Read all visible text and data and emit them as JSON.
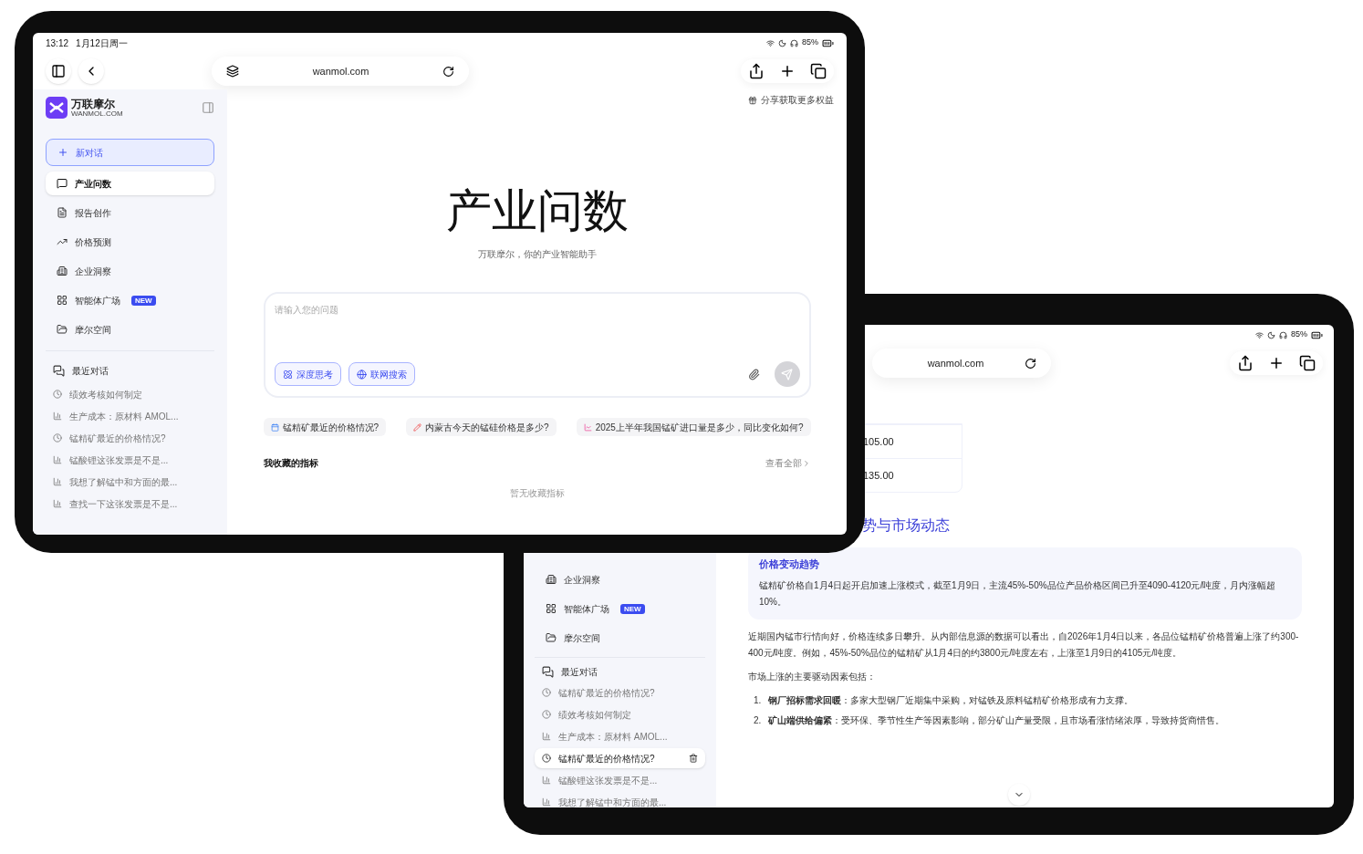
{
  "front": {
    "status": {
      "time": "13:12",
      "date": "1月12日周一",
      "battery": "85%"
    },
    "url": "wanmol.com",
    "brand": {
      "name": "万联摩尔",
      "domain": "WANMOL.COM"
    },
    "new_chat": "新对话",
    "nav": [
      {
        "label": "产业问数",
        "selected": true
      },
      {
        "label": "报告创作",
        "selected": false
      },
      {
        "label": "价格预测",
        "selected": false
      },
      {
        "label": "企业洞察",
        "selected": false
      },
      {
        "label": "智能体广场",
        "selected": false,
        "badge": "NEW"
      },
      {
        "label": "摩尔空间",
        "selected": false
      }
    ],
    "recent_title": "最近对话",
    "history": [
      {
        "label": "绩效考核如何制定",
        "kind": "chat"
      },
      {
        "label": "生产成本：原材料 AMOL...",
        "kind": "report"
      },
      {
        "label": "锰精矿最近的价格情况?",
        "kind": "chat"
      },
      {
        "label": "锰酸锂这张发票是不是...",
        "kind": "report"
      },
      {
        "label": "我想了解锰中和方面的最...",
        "kind": "report"
      },
      {
        "label": "查找一下这张发票是不是...",
        "kind": "report"
      }
    ],
    "share": "分享获取更多权益",
    "hero": {
      "title": "产业问数",
      "subtitle": "万联摩尔，你的产业智能助手"
    },
    "input": {
      "placeholder": "请输入您的问题"
    },
    "modes": [
      {
        "label": "深度思考",
        "kind": "think"
      },
      {
        "label": "联网搜索",
        "kind": "web"
      }
    ],
    "suggestions": [
      {
        "label": "锰精矿最近的价格情况?",
        "kind": "calendar"
      },
      {
        "label": "内蒙古今天的锰硅价格是多少?",
        "kind": "pen"
      },
      {
        "label": "2025上半年我国锰矿进口量是多少，同比变化如何?",
        "kind": "trend"
      }
    ],
    "favorites": {
      "title": "我收藏的指标",
      "link": "查看全部",
      "empty": "暂无收藏指标"
    }
  },
  "back": {
    "status": {
      "battery": "85%"
    },
    "url": "wanmol.com",
    "nav": [
      {
        "label": "企业洞察"
      },
      {
        "label": "智能体广场",
        "badge": "NEW"
      },
      {
        "label": "摩尔空间"
      }
    ],
    "recent_title": "最近对话",
    "history": [
      {
        "label": "锰精矿最近的价格情况?",
        "kind": "chat",
        "selected": false
      },
      {
        "label": "绩效考核如何制定",
        "kind": "chat",
        "selected": false
      },
      {
        "label": "生产成本：原材料 AMOL...",
        "kind": "report",
        "selected": false
      },
      {
        "label": "锰精矿最近的价格情况?",
        "kind": "chat",
        "selected": true
      },
      {
        "label": "锰酸锂这张发票是不是...",
        "kind": "report",
        "selected": false
      },
      {
        "label": "我想了解锰中和方面的最...",
        "kind": "report",
        "selected": false
      }
    ],
    "table_cells": [
      "105.00",
      "135.00"
    ],
    "heading": "势与市场动态",
    "card": {
      "title": "价格变动趋势",
      "text": "锰精矿价格自1月4日起开启加速上涨模式，截至1月9日，主流45%-50%品位产品价格区间已升至4090-4120元/吨度，月内涨幅超10%。"
    },
    "paragraphs": [
      "近期国内锰市行情向好，价格连续多日攀升。从内部信息源的数据可以看出，自2026年1月4日以来，各品位锰精矿价格普遍上涨了约300-400元/吨度。例如，45%-50%品位的锰精矿从1月4日的约3800元/吨度左右，上涨至1月9日的4105元/吨度。",
      "市场上涨的主要驱动因素包括："
    ],
    "list": [
      {
        "number": "1.",
        "text": "**钢厂招标需求回暖**：多家大型钢厂近期集中采购，对锰铁及原料锰精矿价格形成有力支撑。"
      },
      {
        "number": "2.",
        "text": "**矿山端供给偏紧**：受环保、季节性生产等因素影响，部分矿山产量受限，且市场看涨情绪浓厚，导致持货商惜售。"
      }
    ]
  }
}
